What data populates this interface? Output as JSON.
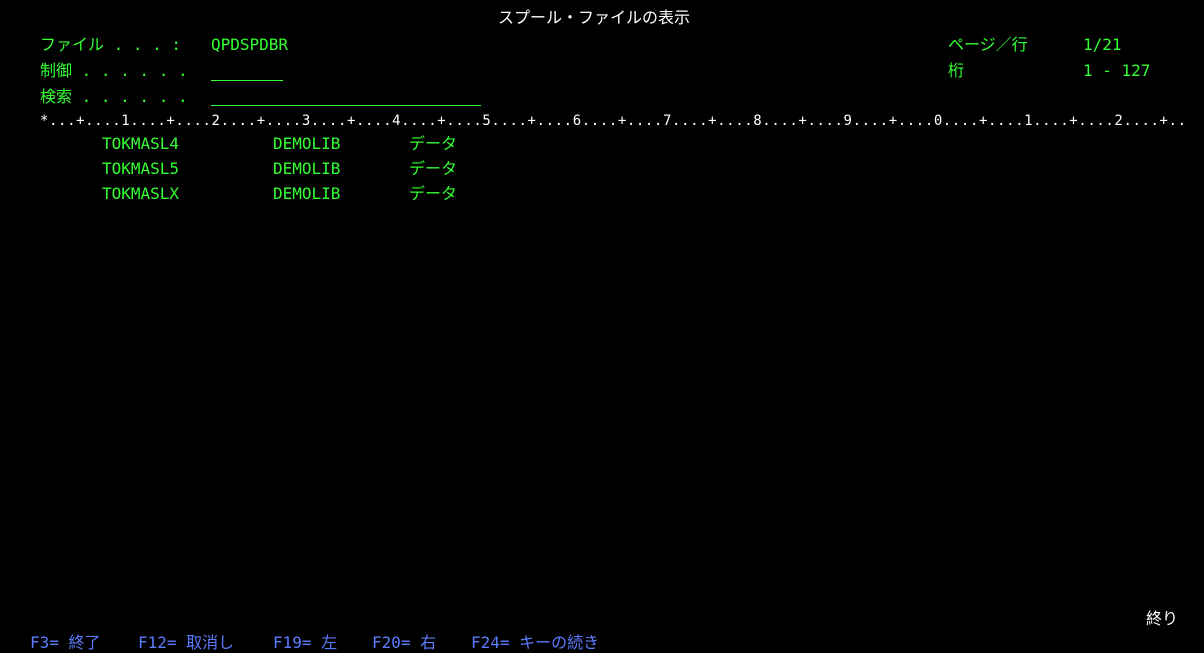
{
  "title": "スプール・ファイルの表示",
  "header": {
    "file_label": "ファイル . . . :",
    "file_value": "QPDSPDBR",
    "control_label": "制御 . . . . . .",
    "search_label": "検索 . . . . . .",
    "page_label": "ページ／行",
    "page_value": "1/21",
    "column_label": "桁",
    "column_value": "1 - 127"
  },
  "ruler": "*...+....1....+....2....+....3....+....4....+....5....+....6....+....7....+....8....+....9....+....0....+....1....+....2....+..",
  "rows": [
    {
      "name": "TOKMASL4",
      "library": "DEMOLIB",
      "type": "データ"
    },
    {
      "name": "TOKMASL5",
      "library": "DEMOLIB",
      "type": "データ"
    },
    {
      "name": "TOKMASLX",
      "library": "DEMOLIB",
      "type": "データ"
    }
  ],
  "status": "終り",
  "fkeys": [
    {
      "label": "F3= 終了"
    },
    {
      "label": "F12= 取消し"
    },
    {
      "label": "F19= 左"
    },
    {
      "label": "F20= 右"
    },
    {
      "label": "F24= キーの続き"
    }
  ],
  "colors": {
    "text_green": "#33ff33",
    "text_white": "#ffffff",
    "text_blue": "#5c7cff",
    "background": "#000000"
  }
}
